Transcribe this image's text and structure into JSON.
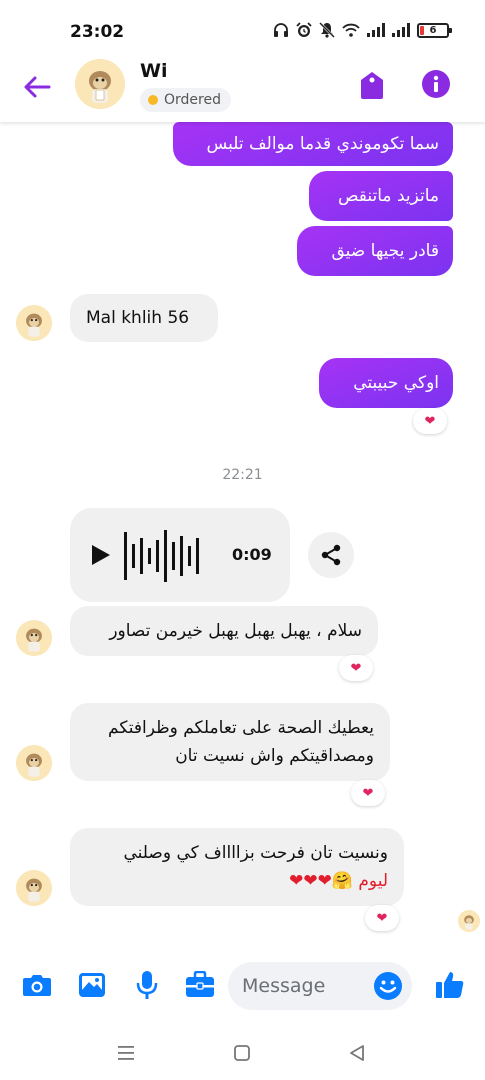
{
  "status_bar": {
    "time": "23:02",
    "battery": "6"
  },
  "header": {
    "name": "Wi",
    "status": "Ordered",
    "status_color": "#f7b924"
  },
  "colors": {
    "accent": "#8a2be2",
    "reaction": "#e0245e"
  },
  "messages": [
    {
      "direction": "out",
      "text": "سما تكوموندي قدما موالف تلبس"
    },
    {
      "direction": "out",
      "text": "ماتزيد ماتنقص"
    },
    {
      "direction": "out",
      "text": "قادر يجيها ضيق"
    },
    {
      "direction": "in",
      "text": "Mal khlih 56"
    },
    {
      "direction": "out",
      "text": "اوكي حبيبتي",
      "reaction": "❤"
    },
    {
      "direction": "in",
      "type": "voice",
      "duration": "0:09"
    },
    {
      "direction": "in",
      "text": "سلام ، يهبل يهبل يهبل خيرمن تصاور",
      "reaction": "❤"
    },
    {
      "direction": "in",
      "lines": [
        "يعطيك الصحة على تعاملكم وظرافتكم",
        "ومصداقيتكم  واش نسيت تان"
      ],
      "reaction": "❤"
    },
    {
      "direction": "in",
      "lines": [
        "ونسيت تان  فرحت بزااااف كي وصلني",
        "ليوم  🤗❤❤❤"
      ],
      "reaction": "❤"
    }
  ],
  "timestamp": "22:21",
  "composer": {
    "placeholder": "Message",
    "icons": [
      "camera-icon",
      "image-icon",
      "microphone-icon",
      "briefcase-icon",
      "emoji-icon",
      "thumbs-up-icon"
    ]
  },
  "nav": {
    "icons": [
      "menu-icon",
      "home-icon",
      "back-icon"
    ]
  }
}
